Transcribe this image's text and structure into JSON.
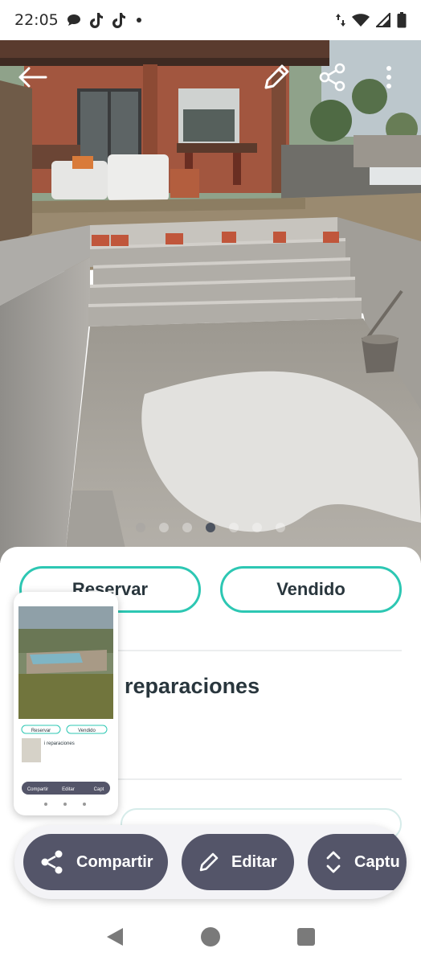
{
  "status_bar": {
    "time": "22:05",
    "icons_left": [
      "chat-bubble-icon",
      "tiktok-icon",
      "tiktok-icon",
      "dot-icon"
    ],
    "icons_right": [
      "data-arrows-icon",
      "wifi-icon",
      "signal-icon",
      "battery-icon"
    ]
  },
  "photo": {
    "actions": [
      "back-arrow-icon",
      "edit-pencil-icon",
      "share-icon",
      "more-vert-icon"
    ],
    "pager": {
      "count": 7,
      "active_index": 3
    }
  },
  "listing": {
    "reserve_label": "Reservar",
    "sold_label": "Vendido",
    "title_fragment": "i reparaciones"
  },
  "thumbnail": {
    "reserve_label": "Reservar",
    "sold_label": "Vendido",
    "title_fragment": "i reparaciones",
    "share_label": "Compartir",
    "edit_label": "Editar",
    "capture_label": "Capt"
  },
  "toolbar": {
    "share_label": "Compartir",
    "edit_label": "Editar",
    "capture_label": "Captu"
  },
  "nav_bar": {
    "buttons": [
      "back-icon",
      "home-icon",
      "recents-icon"
    ]
  },
  "colors": {
    "accent_teal": "#2dc7b3",
    "dark_text": "#29363d",
    "toolbar_button": "#545569"
  }
}
